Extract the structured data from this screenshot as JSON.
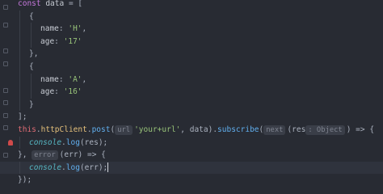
{
  "editor": {
    "lines": [
      {
        "indent": 0,
        "tokens": [
          [
            "kw",
            "const"
          ],
          [
            "key",
            " data "
          ],
          [
            "pun",
            "= ["
          ]
        ]
      },
      {
        "indent": 1,
        "tokens": [
          [
            "pun",
            "{"
          ]
        ]
      },
      {
        "indent": 2,
        "tokens": [
          [
            "key",
            "name"
          ],
          [
            "pun",
            ": "
          ],
          [
            "str",
            "'H'"
          ],
          [
            "pun",
            ","
          ]
        ]
      },
      {
        "indent": 2,
        "tokens": [
          [
            "key",
            "age"
          ],
          [
            "pun",
            ": "
          ],
          [
            "str",
            "'17'"
          ]
        ]
      },
      {
        "indent": 1,
        "tokens": [
          [
            "pun",
            "},"
          ]
        ]
      },
      {
        "indent": 1,
        "tokens": [
          [
            "pun",
            "{"
          ]
        ]
      },
      {
        "indent": 2,
        "tokens": [
          [
            "key",
            "name"
          ],
          [
            "pun",
            ": "
          ],
          [
            "str",
            "'A'"
          ],
          [
            "pun",
            ","
          ]
        ]
      },
      {
        "indent": 2,
        "tokens": [
          [
            "key",
            "age"
          ],
          [
            "pun",
            ": "
          ],
          [
            "str",
            "'16'"
          ]
        ]
      },
      {
        "indent": 1,
        "tokens": [
          [
            "pun",
            "}"
          ]
        ]
      },
      {
        "indent": 0,
        "tokens": [
          [
            "pun",
            "];"
          ]
        ]
      },
      {
        "indent": 0,
        "tokens": [
          [
            "id",
            "this"
          ],
          [
            "pun",
            "."
          ],
          [
            "prop",
            "httpClient"
          ],
          [
            "pun",
            "."
          ],
          [
            "fn",
            "post"
          ],
          [
            "pun",
            "("
          ],
          [
            "hint",
            "url"
          ],
          [
            "str",
            "'your+url'"
          ],
          [
            "pun",
            ", data)."
          ],
          [
            "fn",
            "subscribe"
          ],
          [
            "pun",
            "("
          ],
          [
            "hint",
            "next"
          ],
          [
            "pun",
            "(res"
          ],
          [
            "hint",
            ": Object"
          ],
          [
            "pun",
            ") => {"
          ]
        ]
      },
      {
        "indent": 1,
        "tokens": [
          [
            "it",
            "console"
          ],
          [
            "pun",
            "."
          ],
          [
            "fn",
            "log"
          ],
          [
            "pun",
            "(res);"
          ]
        ]
      },
      {
        "indent": 0,
        "tokens": [
          [
            "pun",
            "}, "
          ],
          [
            "hint",
            "error"
          ],
          [
            "pun",
            "(err) => {"
          ]
        ]
      },
      {
        "indent": 1,
        "current": true,
        "tokens": [
          [
            "it",
            "console"
          ],
          [
            "pun",
            "."
          ],
          [
            "fn",
            "log"
          ],
          [
            "pun",
            "(err);"
          ],
          [
            "cursor",
            ""
          ]
        ]
      },
      {
        "indent": 0,
        "tokens": [
          [
            "pun",
            "});"
          ]
        ]
      }
    ]
  }
}
